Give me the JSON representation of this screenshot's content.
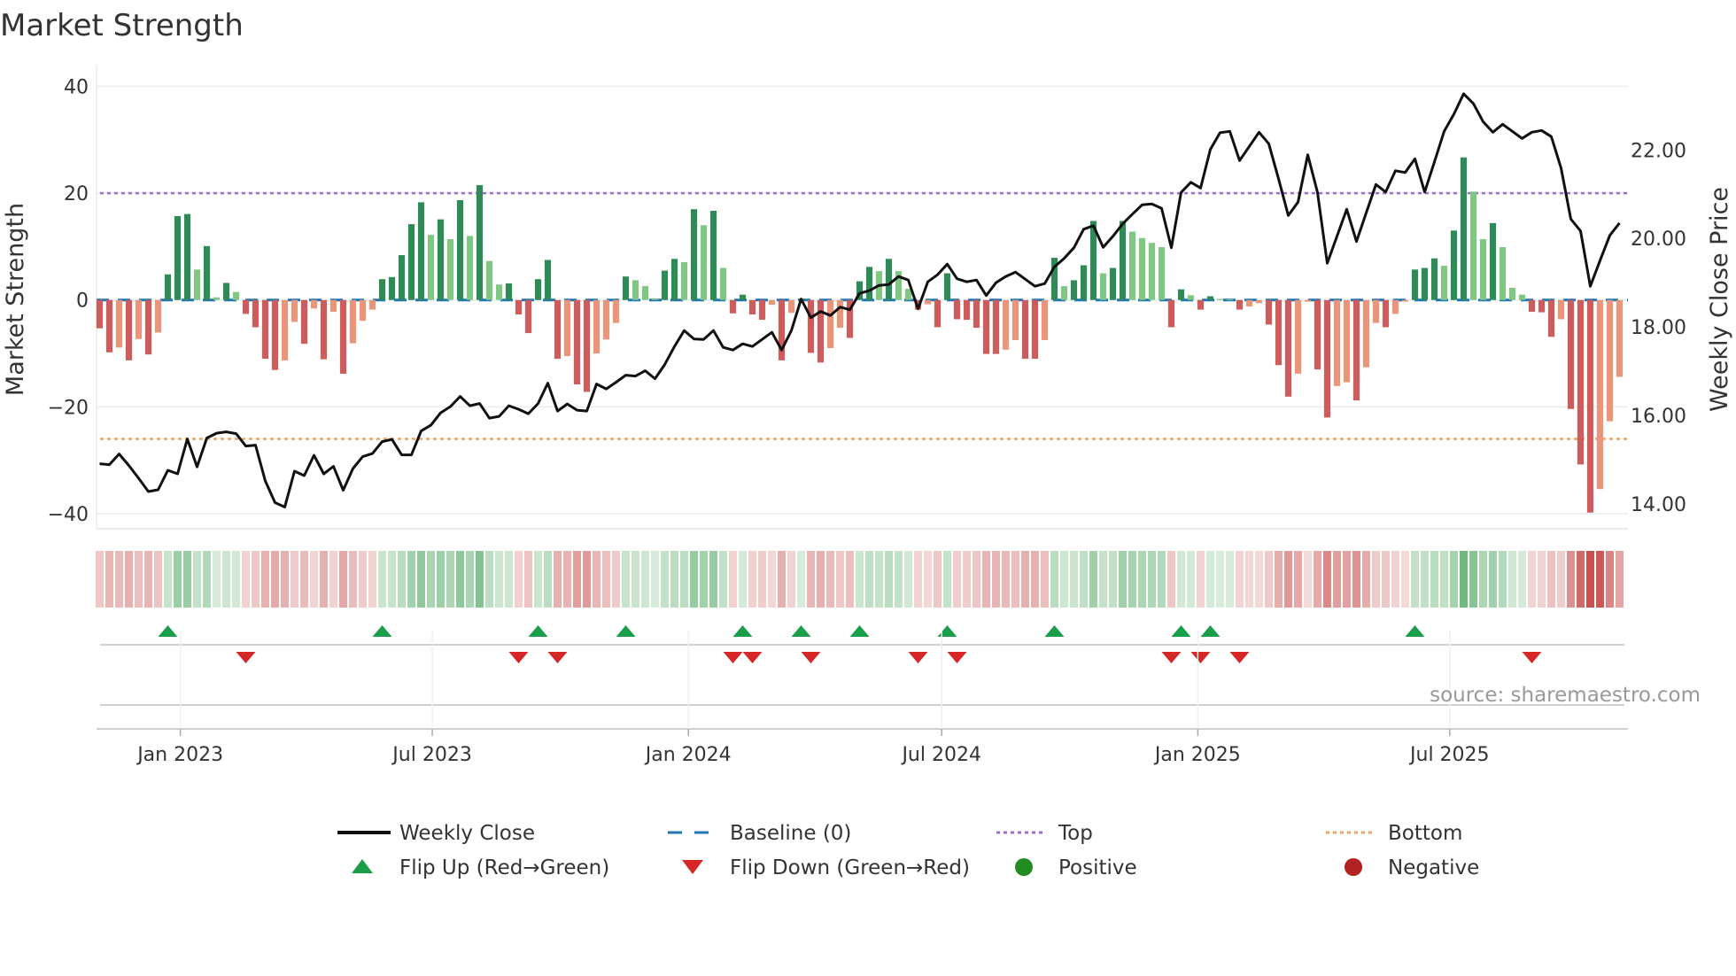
{
  "title": "Market Strength",
  "source": "source: sharemaestro.com",
  "colors": {
    "pos_strong": "#2e8b57",
    "pos_weak": "#81c784",
    "neg_strong": "#cd5c5c",
    "neg_weak": "#e9967a",
    "close": "#111111",
    "baseline": "#1f77b4",
    "top": "#9d6bd8",
    "bottom": "#f4a460",
    "flip_up": "#1a9e4a",
    "flip_down": "#d62728",
    "positive": "#228b22",
    "negative": "#b22222"
  },
  "chart_data": {
    "type": "bar+line",
    "title": "Market Strength",
    "ylabel": "Market Strength",
    "y2label": "Weekly Close Price",
    "start_date": "2022-11-04",
    "frequency": "weekly",
    "ylim": [
      -42,
      44
    ],
    "y2lim": [
      13.54,
      23.92
    ],
    "top_level": 20,
    "bottom_level": -26,
    "baseline": 0,
    "yticks": [
      {
        "v": 40,
        "label": "40"
      },
      {
        "v": 20,
        "label": "20"
      },
      {
        "v": 0,
        "label": "0"
      },
      {
        "v": -20,
        "label": "−20"
      },
      {
        "v": -40,
        "label": "−40"
      }
    ],
    "y2ticks": [
      {
        "v": 22,
        "label": "22.00"
      },
      {
        "v": 20,
        "label": "20.00"
      },
      {
        "v": 18,
        "label": "18.00"
      },
      {
        "v": 16,
        "label": "16.00"
      },
      {
        "v": 14,
        "label": "14.00"
      }
    ],
    "xticks": [
      {
        "date": "2023-01-01",
        "label": "Jan 2023"
      },
      {
        "date": "2023-07-01",
        "label": "Jul 2023"
      },
      {
        "date": "2024-01-01",
        "label": "Jan 2024"
      },
      {
        "date": "2024-07-01",
        "label": "Jul 2024"
      },
      {
        "date": "2025-01-01",
        "label": "Jan 2025"
      },
      {
        "date": "2025-07-01",
        "label": "Jul 2025"
      }
    ],
    "strength": [
      -5.3,
      -9.8,
      -8.9,
      -11.3,
      -7.3,
      -10.2,
      -6.1,
      4.8,
      15.7,
      16.1,
      5.7,
      10.1,
      0.5,
      3.2,
      1.5,
      -2.6,
      -5.1,
      -11,
      -13.1,
      -11.3,
      -4.1,
      -8.2,
      -1.6,
      -11.1,
      -2.2,
      -13.8,
      -8.1,
      -3.9,
      -1.8,
      3.9,
      4.3,
      8.4,
      14.2,
      18.3,
      12.2,
      15.1,
      11.4,
      18.7,
      12.0,
      21.5,
      7.3,
      2.9,
      3.1,
      -2.7,
      -6.2,
      3.9,
      7.5,
      -11,
      -10.5,
      -15.8,
      -17.2,
      -10,
      -7.4,
      -4.3,
      4.4,
      3.7,
      2.6,
      0.3,
      5.5,
      7.7,
      7.1,
      17.0,
      14.0,
      16.7,
      6.0,
      -2.5,
      1.0,
      -2.7,
      -3.7,
      -0.9,
      -11.3,
      -2.4,
      0.3,
      -9.9,
      -11.7,
      -9,
      -5.2,
      -7.1,
      3.5,
      6.2,
      5.4,
      7.7,
      5.4,
      2.1,
      -1.8,
      -0.8,
      -5.1,
      5.0,
      -3.6,
      -3.7,
      -5.2,
      -10.1,
      -10.1,
      -9.3,
      -7.5,
      -11,
      -11,
      -7.5,
      7.9,
      2.6,
      3.7,
      6.5,
      14.8,
      5.0,
      6.0,
      14.8,
      12.8,
      11.6,
      10.7,
      9.9,
      -5.1,
      2.0,
      0.9,
      -1.8,
      0.7,
      0.2,
      0.1,
      -1.8,
      -1.2,
      -0.6,
      -4.6,
      -12.2,
      -18.1,
      -13.8,
      -0.3,
      -13,
      -22,
      -16.1,
      -15.4,
      -18.8,
      -12.6,
      -4.3,
      -5.1,
      -2.6,
      -0.3,
      5.7,
      6.0,
      7.8,
      6.4,
      13.0,
      26.7,
      20.3,
      11.4,
      14.4,
      9.9,
      2.3,
      1.0,
      -2.2,
      -2.3,
      -6.9,
      -3.6,
      -20.4,
      -30.8,
      -39.8,
      -35.4,
      -22.7,
      -14.4
    ],
    "weekly_close": [
      14.91,
      14.89,
      15.13,
      14.87,
      14.58,
      14.28,
      14.32,
      14.76,
      14.68,
      15.47,
      14.84,
      15.49,
      15.6,
      15.63,
      15.59,
      15.31,
      15.33,
      14.52,
      14.03,
      13.93,
      14.74,
      14.64,
      15.1,
      14.68,
      14.85,
      14.31,
      14.8,
      15.07,
      15.14,
      15.41,
      15.46,
      15.11,
      15.11,
      15.65,
      15.78,
      16.06,
      16.2,
      16.43,
      16.22,
      16.27,
      15.94,
      15.98,
      16.22,
      16.14,
      16.04,
      16.27,
      16.73,
      16.1,
      16.26,
      16.12,
      16.1,
      16.71,
      16.6,
      16.75,
      16.91,
      16.89,
      17.01,
      16.83,
      17.15,
      17.56,
      17.92,
      17.73,
      17.72,
      17.92,
      17.54,
      17.48,
      17.62,
      17.56,
      17.72,
      17.88,
      17.48,
      17.92,
      18.63,
      18.21,
      18.35,
      18.26,
      18.45,
      18.39,
      18.76,
      18.82,
      18.94,
      18.96,
      19.14,
      19.06,
      18.41,
      19.02,
      19.18,
      19.42,
      19.09,
      19.02,
      19.06,
      18.71,
      19.0,
      19.14,
      19.24,
      19.08,
      18.92,
      18.98,
      19.36,
      19.55,
      19.79,
      20.21,
      20.29,
      19.8,
      20.05,
      20.33,
      20.55,
      20.76,
      20.78,
      20.68,
      19.79,
      21.04,
      21.27,
      21.14,
      22.01,
      22.39,
      22.42,
      21.76,
      22.08,
      22.4,
      22.14,
      21.35,
      20.52,
      20.82,
      21.89,
      21.04,
      19.44,
      20.05,
      20.66,
      19.93,
      20.58,
      21.22,
      21.05,
      21.53,
      21.49,
      21.8,
      21.05,
      21.73,
      22.42,
      22.81,
      23.27,
      23.05,
      22.64,
      22.4,
      22.58,
      22.42,
      22.26,
      22.4,
      22.44,
      22.3,
      21.59,
      20.44,
      20.17,
      18.92,
      19.5,
      20.07,
      20.35
    ],
    "legend": {
      "placement": "bottom",
      "items": [
        {
          "key": "close",
          "label": "Weekly Close"
        },
        {
          "key": "baseline",
          "label": "Baseline (0)"
        },
        {
          "key": "top",
          "label": "Top"
        },
        {
          "key": "bottom",
          "label": "Bottom"
        },
        {
          "key": "flip_up",
          "label": "Flip Up (Red→Green)"
        },
        {
          "key": "flip_down",
          "label": "Flip Down (Green→Red)"
        },
        {
          "key": "positive",
          "label": "Positive"
        },
        {
          "key": "negative",
          "label": "Negative"
        }
      ]
    }
  }
}
